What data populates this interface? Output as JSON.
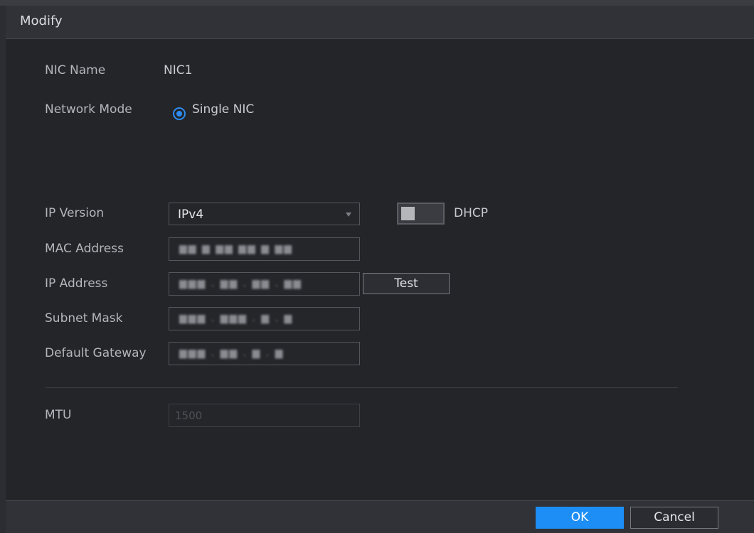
{
  "dialog": {
    "title": "Modify"
  },
  "fields": {
    "nic_name": {
      "label": "NIC Name",
      "value": "NIC1"
    },
    "network_mode": {
      "label": "Network Mode",
      "option": "Single NIC",
      "selected": true
    },
    "ip_version": {
      "label": "IP Version",
      "value": "IPv4"
    },
    "dhcp": {
      "label": "DHCP",
      "enabled": false
    },
    "mac_address": {
      "label": "MAC Address"
    },
    "ip_address": {
      "label": "IP Address"
    },
    "subnet_mask": {
      "label": "Subnet Mask"
    },
    "default_gateway": {
      "label": "Default Gateway"
    },
    "mtu": {
      "label": "MTU",
      "placeholder": "1500"
    }
  },
  "buttons": {
    "test": "Test",
    "ok": "OK",
    "cancel": "Cancel"
  },
  "colors": {
    "accent": "#1d8ef5",
    "background": "#232529",
    "title_bar": "#303237"
  }
}
